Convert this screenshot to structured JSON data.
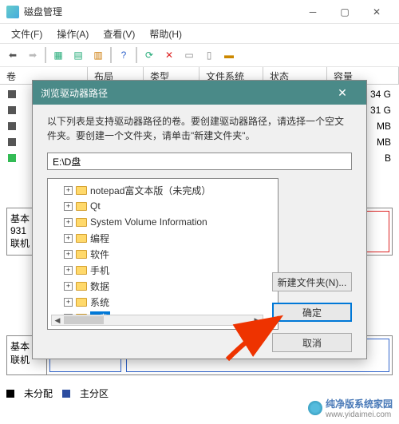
{
  "window": {
    "title": "磁盘管理"
  },
  "menu": {
    "file": "文件(F)",
    "action": "操作(A)",
    "view": "查看(V)",
    "help": "帮助(H)"
  },
  "headers": {
    "vol": "卷",
    "layout": "布局",
    "type": "类型",
    "fs": "文件系统",
    "status": "状态",
    "cap": "容量"
  },
  "caps": {
    "c1": "34 G",
    "c2": "31 G",
    "c3": "MB",
    "c4": "MB",
    "c5": "B"
  },
  "disk": {
    "base": "基本",
    "size": "931",
    "online": "联机",
    "base2": "基本",
    "online2": "联机"
  },
  "legend": {
    "unalloc": "未分配",
    "primary": "主分区"
  },
  "watermark": {
    "text": "纯净版系统家园",
    "url": "www.yidaimei.com"
  },
  "dialog": {
    "title": "浏览驱动器路径",
    "msg": "以下列表是支持驱动器路径的卷。要创建驱动器路径，请选择一个空文件夹。要创建一个文件夹，请单击\"新建文件夹\"。",
    "path": "E:\\D盘",
    "items": [
      {
        "label": "notepad富文本版（未完成）",
        "sel": false
      },
      {
        "label": "Qt",
        "sel": false
      },
      {
        "label": "System Volume Information",
        "sel": false
      },
      {
        "label": "编程",
        "sel": false
      },
      {
        "label": "软件",
        "sel": false
      },
      {
        "label": "手机",
        "sel": false
      },
      {
        "label": "数据",
        "sel": false
      },
      {
        "label": "系统",
        "sel": false
      },
      {
        "label": "D盘",
        "sel": true
      }
    ],
    "newfolder": "新建文件夹(N)...",
    "ok": "确定",
    "cancel": "取消"
  }
}
